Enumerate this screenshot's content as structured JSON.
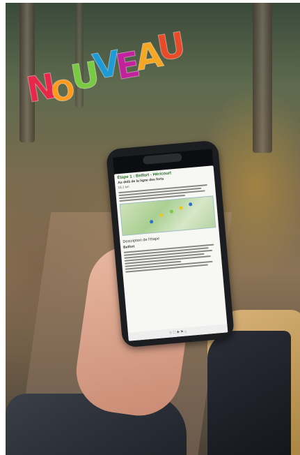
{
  "title_word": {
    "letters": [
      {
        "char": "N",
        "color": "#e8284b"
      },
      {
        "char": "O",
        "color": "#ff9a1f"
      },
      {
        "char": "U",
        "color": "#7ac943"
      },
      {
        "char": "V",
        "color": "#1e9ad6"
      },
      {
        "char": "E",
        "color": "#c2229b"
      },
      {
        "char": "A",
        "color": "#f5a623"
      },
      {
        "char": "U",
        "color": "#e84b2a"
      }
    ]
  },
  "phone_screen": {
    "stage_title": "Étape 1 : Belfort - Héricourt",
    "stage_subtitle": "Au delà de la ligne des forts",
    "stage_meta": "15,1 km",
    "section_heading": "Description de l'étape",
    "section_place": "Belfort",
    "bottom_bar": "⚐ ⛶ ✚ ⚑ ⌂"
  }
}
